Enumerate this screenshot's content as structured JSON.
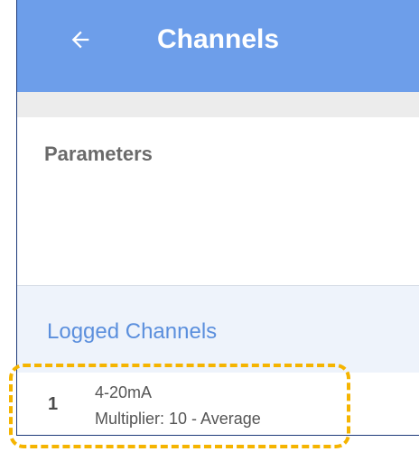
{
  "appbar": {
    "title": "Channels",
    "back_icon": "arrow-left-icon",
    "color": "#6d9eea"
  },
  "parameters": {
    "title": "Parameters"
  },
  "logged_channels": {
    "title": "Logged Channels",
    "items": [
      {
        "number": "1",
        "type": "4-20mA",
        "detail": "Multiplier: 10 - Average"
      }
    ]
  },
  "highlight_color": "#f5b400"
}
